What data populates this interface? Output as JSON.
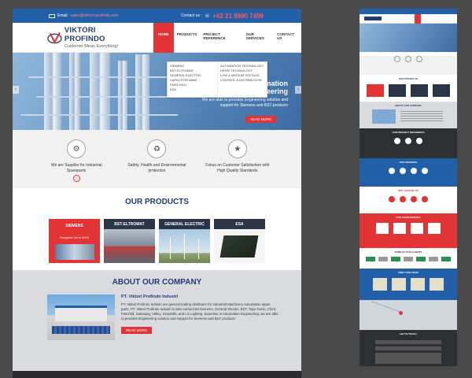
{
  "main": {
    "topbar": {
      "email_label": "Email:",
      "email": "sales@viktori-profindo.com",
      "contact_label": "Contact us :",
      "phone": "+62 21 8990 7499"
    },
    "logo": {
      "name": "VIKTORI PROFINDO",
      "tagline": "Customer Mean Everything!"
    },
    "nav": [
      "HOME",
      "PRODUCTS",
      "PROJECT REFERENCE",
      "OUR SERVICES",
      "CONTACT US"
    ],
    "dropdown": {
      "col1": [
        "SIEMENS",
        "BST-ELTROMAT",
        "GENERAL ELECTRIC",
        "CAPACITOR BANK",
        "FAIRCHILD",
        "ESA"
      ],
      "col2": [
        "AUTOMATION TECHNOLOGY",
        "DRIVE TECHNOLOGY",
        "LOW & MEDIUM VOLTAGE CONTROL & DISTRIBUTION"
      ]
    },
    "hero": {
      "heading": "Expertise in Automation Engineering",
      "text": "We are able to provides Engineering solution and support for Siemens and BST products",
      "button": "READ MORE",
      "prev": "‹",
      "next": "›"
    },
    "features": [
      {
        "label": "We are Supplier for Industrial Spareparts",
        "icon": "⚙"
      },
      {
        "label": "Safety, Health and Environmental protection",
        "icon": "♻"
      },
      {
        "label": "Fokus on Customer Satisfaction with High Quality Standards",
        "icon": "★"
      }
    ],
    "feature_btn": "›",
    "products": {
      "title": "OUR PRODUCTS",
      "items": [
        {
          "name": "SIEMENS",
          "sub": "Ranghed 1st in 2015",
          "color": "#e23434"
        },
        {
          "name": "BST-ELTROMAT",
          "sub": "",
          "color": "#2b3548"
        },
        {
          "name": "GENERAL ELECTRIC",
          "sub": "",
          "color": "#2b3548"
        },
        {
          "name": "ESA",
          "sub": "",
          "color": "#2b3548"
        }
      ]
    },
    "about": {
      "title": "ABOUT OUR COMPANY",
      "heading": "PT. Viktori Profindo Industri",
      "text": "PT. Viktori Profindo Industri are general trading distributor for Industrial Machinery Automation spare parts. PT. Viktori Profindo Industri is also Authorized Siemens, General Electric, BST, Topo Denki, Chint, Fairchild, Samsung, Valley, Graymills, and LG Lighting. Expertise in Automation Engineering, we are able to provides Engineering solution and support for Siemens and BST products.",
      "button": "READ MORE"
    }
  },
  "side": {
    "titles": [
      "OUR PRODUCTS",
      "ABOUT OUR COMPANY",
      "OUR PROJECT REFERENCE",
      "OUR SERVICES",
      "WHY CHOOSE US",
      "OUR ACHIEVEMENTS",
      "SOME OF OUR CLIENTS",
      "MEET OUR TEAM",
      "GET IN TOUCH"
    ]
  },
  "colors": {
    "brand_blue": "#2160a8",
    "accent_red": "#e23434",
    "navy": "#243a73"
  }
}
